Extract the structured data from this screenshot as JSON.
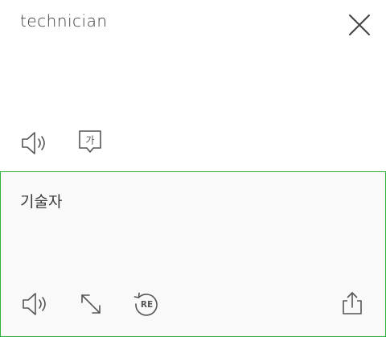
{
  "source": {
    "text": "technician"
  },
  "result": {
    "text": "기술자"
  },
  "icons": {
    "close": "close-icon",
    "source_speaker": "speaker-icon",
    "korean_character": "korean-character-icon",
    "result_speaker": "speaker-icon",
    "expand": "expand-arrows-icon",
    "retranslate": "retranslate-icon",
    "share": "share-icon",
    "korean_glyph": "가",
    "retranslate_glyph": "RE"
  },
  "colors": {
    "accent_border": "#2fae3a",
    "result_background": "#f9f9f9",
    "icon_stroke": "#555555"
  }
}
